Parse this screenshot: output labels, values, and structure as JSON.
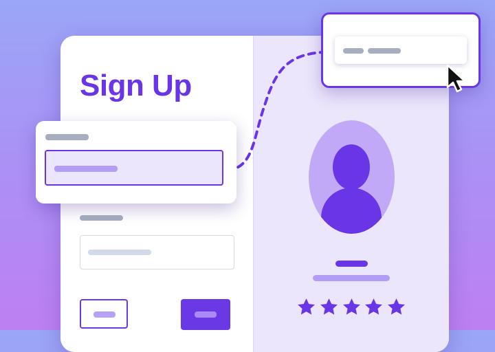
{
  "form": {
    "title": "Sign Up"
  },
  "icons": {
    "avatar": "user-avatar-icon",
    "star": "star-icon",
    "cursor": "mouse-pointer-icon"
  },
  "profile": {
    "rating": {
      "value": 5,
      "max": 5
    }
  },
  "colors": {
    "accent": "#6a35e6",
    "accent_light": "#b39cf3",
    "panel_bg": "#ece6fc",
    "placeholder": "#a7aec0"
  }
}
